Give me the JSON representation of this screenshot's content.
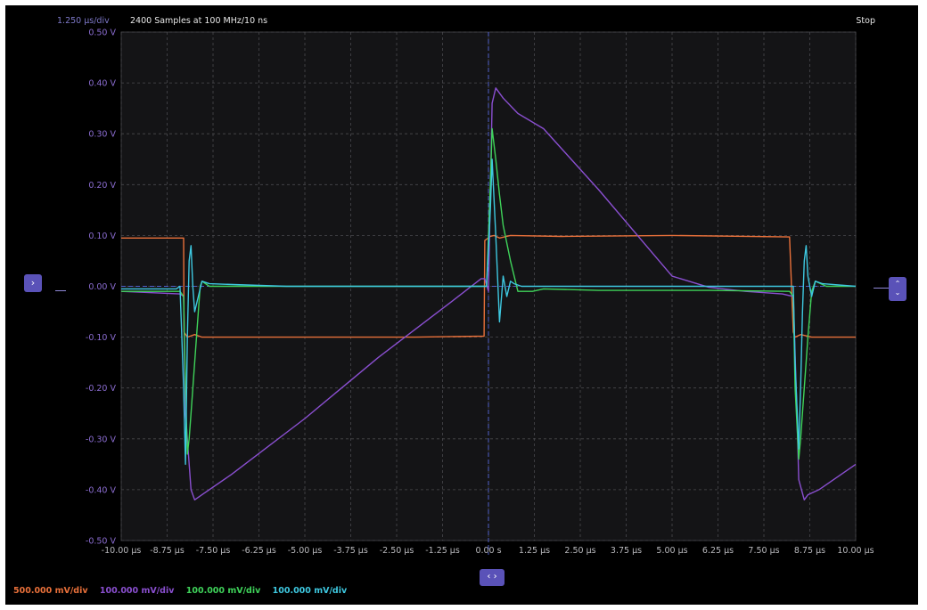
{
  "header": {
    "timebase": "1.250 µs/div",
    "samples": "2400 Samples at 100 MHz/10 ns",
    "state": "Stop"
  },
  "controls": {
    "left_marker_icon": "chevron-right-icon",
    "right_marker_icon": "up-down-chevrons-icon",
    "bottom_marker_icon": "left-right-chevrons-icon"
  },
  "channels": [
    {
      "scale": "500.000 mV/div",
      "color": "#e8703a"
    },
    {
      "scale": "100.000 mV/div",
      "color": "#8a4fd0"
    },
    {
      "scale": "100.000 mV/div",
      "color": "#3fd35a"
    },
    {
      "scale": "100.000 mV/div",
      "color": "#3ec8e0"
    }
  ],
  "chart_data": {
    "type": "line",
    "xlabel": "",
    "ylabel": "",
    "xlim": [
      -10.0,
      10.0
    ],
    "ylim": [
      -0.5,
      0.5
    ],
    "grid": true,
    "x_ticks": [
      "-10.00 µs",
      "-8.75 µs",
      "-7.50 µs",
      "-6.25 µs",
      "-5.00 µs",
      "-3.75 µs",
      "-2.50 µs",
      "-1.25 µs",
      "0.00 s",
      "1.25 µs",
      "2.50 µs",
      "3.75 µs",
      "5.00 µs",
      "6.25 µs",
      "7.50 µs",
      "8.75 µs",
      "10.00 µs"
    ],
    "y_ticks": [
      "0.50 V",
      "0.40 V",
      "0.30 V",
      "0.20 V",
      "0.10 V",
      "0.00 V",
      "-0.10 V",
      "-0.20 V",
      "-0.30 V",
      "-0.40 V",
      "-0.50 V"
    ],
    "series": [
      {
        "color": "#e8703a",
        "x": [
          -10.0,
          -8.3,
          -8.29,
          -8.2,
          -8.0,
          -7.8,
          -2.0,
          -0.12,
          -0.1,
          0.05,
          0.15,
          0.3,
          0.6,
          2.0,
          5.0,
          8.2,
          8.3,
          8.35,
          8.5,
          8.8,
          10.0
        ],
        "y": [
          0.095,
          0.095,
          -0.09,
          -0.1,
          -0.095,
          -0.1,
          -0.1,
          -0.098,
          0.09,
          0.098,
          0.1,
          0.095,
          0.1,
          0.098,
          0.1,
          0.097,
          -0.09,
          -0.1,
          -0.095,
          -0.1,
          -0.1
        ]
      },
      {
        "color": "#8a4fd0",
        "x": [
          -10.0,
          -8.4,
          -8.3,
          -8.25,
          -8.1,
          -8.0,
          -7.8,
          -7.0,
          -5.0,
          -3.0,
          -1.0,
          -0.2,
          -0.1,
          0.0,
          0.1,
          0.2,
          0.4,
          0.8,
          1.5,
          3.0,
          5.0,
          6.0,
          7.0,
          8.0,
          8.3,
          8.4,
          8.45,
          8.6,
          8.7,
          9.0,
          10.0
        ],
        "y": [
          -0.01,
          -0.015,
          -0.02,
          -0.25,
          -0.4,
          -0.42,
          -0.41,
          -0.37,
          -0.26,
          -0.14,
          -0.03,
          0.015,
          0.015,
          -0.01,
          0.36,
          0.39,
          0.37,
          0.34,
          0.31,
          0.19,
          0.02,
          -0.002,
          -0.01,
          -0.015,
          -0.02,
          -0.25,
          -0.38,
          -0.42,
          -0.41,
          -0.4,
          -0.35
        ]
      },
      {
        "color": "#3fd35a",
        "x": [
          -10.0,
          -8.4,
          -8.3,
          -8.25,
          -8.2,
          -8.15,
          -8.1,
          -8.0,
          -7.9,
          -7.85,
          -7.8,
          -7.6,
          -6.0,
          -3.0,
          -0.2,
          -0.05,
          0.05,
          0.1,
          0.2,
          0.3,
          0.4,
          0.6,
          0.8,
          1.0,
          1.2,
          1.5,
          3.0,
          6.0,
          8.2,
          8.3,
          8.35,
          8.45,
          8.5,
          8.6,
          8.7,
          8.8,
          8.9,
          9.2,
          10.0
        ],
        "y": [
          -0.01,
          -0.01,
          -0.02,
          -0.2,
          -0.33,
          -0.3,
          -0.25,
          -0.15,
          -0.05,
          0.0,
          0.01,
          0.0,
          0.0,
          0.0,
          0.0,
          0.0,
          0.2,
          0.31,
          0.25,
          0.18,
          0.12,
          0.05,
          -0.01,
          -0.01,
          -0.01,
          -0.005,
          -0.008,
          -0.008,
          -0.01,
          -0.02,
          -0.2,
          -0.34,
          -0.3,
          -0.2,
          -0.1,
          -0.01,
          0.01,
          0.0,
          0.0
        ]
      },
      {
        "color": "#3ec8e0",
        "x": [
          -10.0,
          -8.5,
          -8.4,
          -8.35,
          -8.3,
          -8.25,
          -8.2,
          -8.15,
          -8.1,
          -8.05,
          -8.0,
          -7.9,
          -7.8,
          -7.6,
          -5.5,
          -3.0,
          -0.2,
          -0.05,
          0.05,
          0.1,
          0.2,
          0.3,
          0.4,
          0.5,
          0.6,
          0.7,
          0.9,
          1.2,
          3.0,
          6.0,
          8.2,
          8.3,
          8.35,
          8.45,
          8.5,
          8.55,
          8.6,
          8.65,
          8.7,
          8.8,
          8.9,
          9.1,
          10.0
        ],
        "y": [
          -0.005,
          -0.005,
          0.0,
          -0.1,
          -0.2,
          -0.35,
          -0.1,
          0.05,
          0.08,
          0.0,
          -0.05,
          -0.02,
          0.01,
          0.005,
          0.0,
          0.0,
          0.0,
          0.0,
          0.15,
          0.25,
          0.1,
          -0.07,
          0.02,
          -0.02,
          0.01,
          0.005,
          0.0,
          0.0,
          0.0,
          0.0,
          0.0,
          0.0,
          -0.15,
          -0.32,
          -0.2,
          -0.05,
          0.05,
          0.08,
          0.02,
          -0.02,
          0.01,
          0.005,
          0.0
        ]
      }
    ]
  }
}
